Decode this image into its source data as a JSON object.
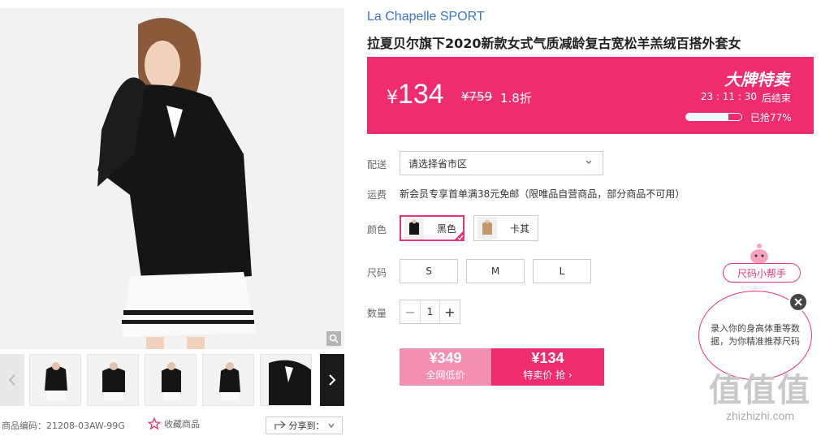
{
  "gallery": {
    "sku_text": "商品编码：21208-03AW-99G",
    "favorite_label": "收藏商品",
    "share_label": "分享到："
  },
  "product": {
    "brand": "La Chapelle SPORT",
    "title": "拉夏贝尔旗下2020新款女式气质减龄复古宽松羊羔绒百搭外套女"
  },
  "price_banner": {
    "currency": "¥",
    "price": "134",
    "original_price": "¥759",
    "discount": "1.8折",
    "sale_title": "大牌特卖",
    "countdown": "23 : 11 : 30",
    "countdown_suffix": "后结束",
    "sold_percent": 77,
    "sold_text": "已抢77%"
  },
  "shipping": {
    "label": "配送",
    "select_value": "请选择省市区"
  },
  "freight": {
    "label": "运费",
    "text": "新会员专享首单满38元免邮（限唯品自营商品，部分商品不可用）"
  },
  "color": {
    "label": "颜色",
    "options": [
      {
        "name": "黑色",
        "selected": true
      },
      {
        "name": "卡其",
        "selected": false
      }
    ]
  },
  "size": {
    "label": "尺码",
    "options": [
      "S",
      "M",
      "L"
    ]
  },
  "quantity": {
    "label": "数量",
    "value": "1",
    "minus": "−",
    "plus": "+"
  },
  "buy": {
    "compare_price": "¥349",
    "compare_label": "全网低价",
    "sale_price": "¥134",
    "sale_label": "特卖价 抢 ›"
  },
  "size_helper": {
    "button_label": "尺码小帮手",
    "bubble_text": "录入你的身高体重等数据，为你精准推荐尺码"
  },
  "watermark": {
    "logo": "值值值",
    "url": "zhizhizhi.com"
  },
  "colors": {
    "accent": "#f02d6c",
    "brand_link": "#3a73c8"
  }
}
